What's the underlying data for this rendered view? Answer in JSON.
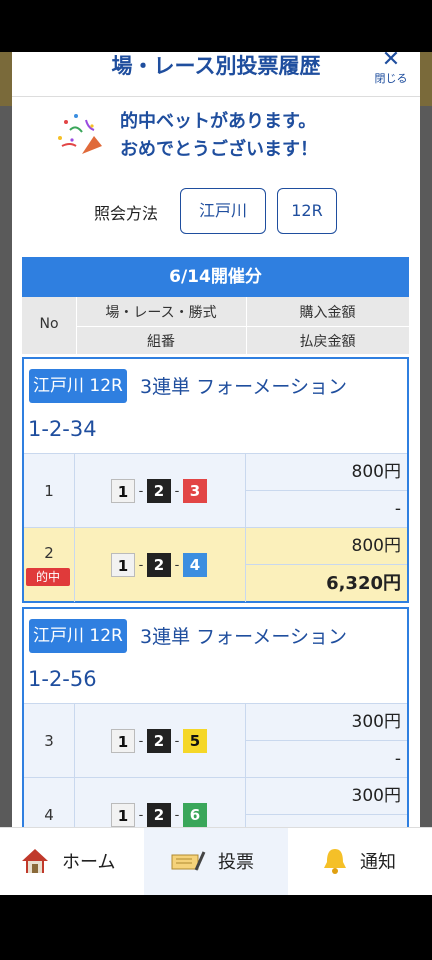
{
  "modal": {
    "title": "場・レース別投票履歴",
    "close_label": "閉じる",
    "congrats_line1": "的中ベットがあります。",
    "congrats_line2": "おめでとうございます！",
    "query_label": "照会方法",
    "query_venue": "江戸川",
    "query_race": "12R"
  },
  "table": {
    "date_label": "6/14開催分",
    "col_no": "No",
    "col_race": "場・レース・勝式",
    "col_combo": "組番",
    "col_buy": "購入金額",
    "col_pay": "払戻金額"
  },
  "races": [
    {
      "venue_race": "江戸川 12R",
      "bet_type": "3連単 フォーメーション",
      "combo": "1-2-34",
      "rows": [
        {
          "no": "1",
          "b1": "1",
          "b2": "2",
          "b3": "3",
          "buy": "800円",
          "pay": "-",
          "hit": false
        },
        {
          "no": "2",
          "b1": "1",
          "b2": "2",
          "b3": "4",
          "buy": "800円",
          "pay": "6,320円",
          "hit": true,
          "hit_label": "的中"
        }
      ]
    },
    {
      "venue_race": "江戸川 12R",
      "bet_type": "3連単 フォーメーション",
      "combo": "1-2-56",
      "rows": [
        {
          "no": "3",
          "b1": "1",
          "b2": "2",
          "b3": "5",
          "buy": "300円",
          "pay": "-",
          "hit": false
        },
        {
          "no": "4",
          "b1": "1",
          "b2": "2",
          "b3": "6",
          "buy": "300円",
          "pay": "-",
          "hit": false
        }
      ]
    }
  ],
  "dash": "-",
  "nav": {
    "home": "ホーム",
    "vote": "投票",
    "notice": "通知"
  },
  "colors": {
    "accent": "#2f7fe0",
    "title_blue": "#1f4e9e",
    "hit_red": "#e03a3a",
    "hit_row": "#fbf0bb"
  }
}
